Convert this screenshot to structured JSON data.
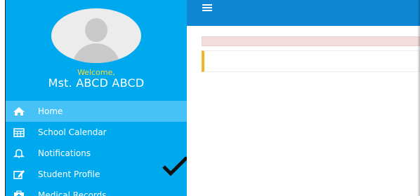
{
  "sidebar": {
    "welcome": "Welcome,",
    "user_name": "Mst. ABCD ABCD",
    "items": [
      {
        "label": "Home",
        "icon": "home-icon",
        "active": true
      },
      {
        "label": "School Calendar",
        "icon": "calendar-icon",
        "active": false
      },
      {
        "label": "Notifications",
        "icon": "bell-icon",
        "active": false
      },
      {
        "label": "Student Profile",
        "icon": "edit-icon",
        "active": false
      },
      {
        "label": "Medical Records",
        "icon": "medical-icon",
        "active": false
      }
    ]
  },
  "topbar": {
    "menu_icon": "hamburger-icon"
  },
  "colors": {
    "sidebar_bg": "#00a9ee",
    "active_item_bg": "#47c2f7",
    "active_indicator": "#f0a92a",
    "welcome_text": "#ffd93a",
    "topbar_bg": "#0f86d4",
    "alert_bg": "#f4dcdc",
    "panel_accent": "#f3b425"
  }
}
